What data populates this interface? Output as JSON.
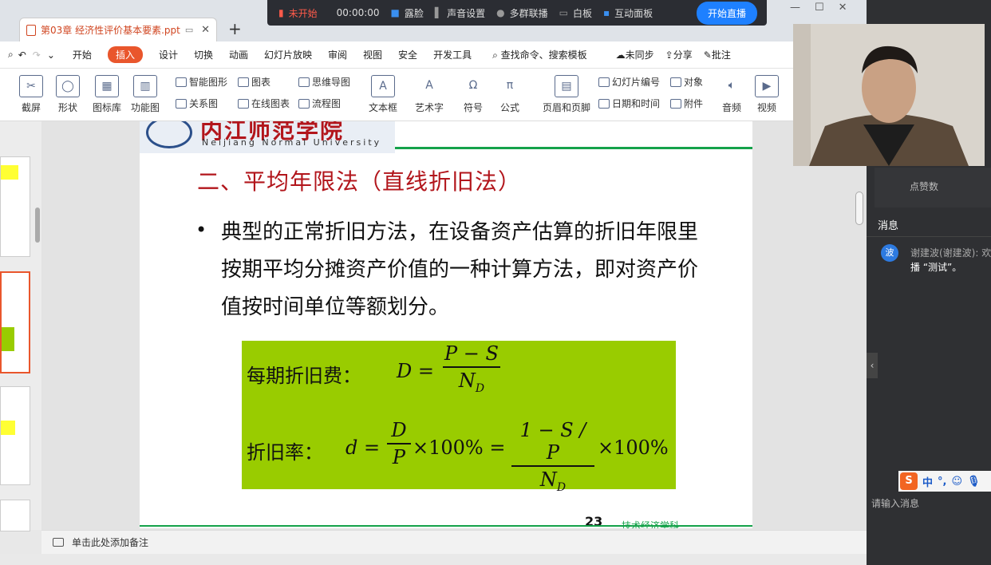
{
  "tab": {
    "title": "第03章 经济性评价基本要素.ppt",
    "add": "+"
  },
  "live": {
    "status": "未开始",
    "timer": "00:00:00",
    "items": [
      "露脸",
      "声音设置",
      "多群联播",
      "白板",
      "互动面板"
    ],
    "start": "开始直播"
  },
  "menu": {
    "items": [
      "开始",
      "插入",
      "设计",
      "切换",
      "动画",
      "幻灯片放映",
      "审阅",
      "视图",
      "安全",
      "开发工具"
    ],
    "active": "插入",
    "search": "查找命令、搜索模板",
    "sync": "未同步",
    "share": "分享",
    "comment": "批注"
  },
  "ribbon": {
    "big": [
      "截屏",
      "形状",
      "图标库",
      "功能图",
      "文本框",
      "艺术字",
      "符号",
      "公式",
      "页眉和页脚",
      "音频",
      "视频"
    ],
    "small": [
      "智能图形",
      "图表",
      "思维导图",
      "关系图",
      "在线图表",
      "流程图",
      "幻灯片编号",
      "对象",
      "日期和时间",
      "附件"
    ]
  },
  "slide": {
    "logo_cn": "内江师范学院",
    "logo_en": "Neijiang Normal University",
    "title": "二、平均年限法（直线折旧法）",
    "bullet": "典型的正常折旧方法，在设备资产估算的折旧年限里按期平均分摊资产价值的一种计算方法，即对资产价值按时间单位等额划分。",
    "formula1_label": "每期折旧费：",
    "formula1_lhs": "D =",
    "formula1_num": "P − S",
    "formula1_den": "N",
    "formula1_den_sub": "D",
    "formula2_label": "折旧率：",
    "formula2_lhs": "d =",
    "formula2_num1": "D",
    "formula2_den1": "P",
    "formula2_mid": "×100% =",
    "formula2_num2": "1 − S / P",
    "formula2_den2": "N",
    "formula2_den2_sub": "D",
    "formula2_end": "×100%",
    "page_number": "23",
    "footer": "技术经济学科"
  },
  "notes": {
    "placeholder": "单击此处添加备注"
  },
  "panel": {
    "likes": "点赞数",
    "messages_title": "消息",
    "avatar": "波",
    "sender": "谢建波(谢建波): 欢",
    "message": "播 “测试”。",
    "input_placeholder": "请输入消息",
    "ime": "中"
  },
  "colors": {
    "accent": "#e9562c",
    "slide_title": "#b2151b",
    "formula_bg": "#99cc00",
    "live_button": "#1e80ff"
  }
}
